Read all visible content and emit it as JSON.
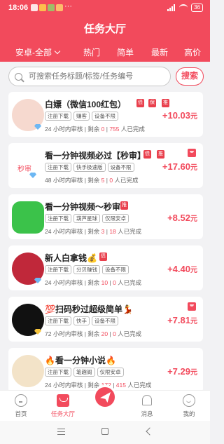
{
  "status_bar": {
    "time": "18:06",
    "more": "···",
    "battery": "36"
  },
  "header": {
    "title": "任务大厅",
    "region_filter": "安卓-全部",
    "tabs": [
      "热门",
      "简单",
      "最新",
      "高价"
    ]
  },
  "search": {
    "placeholder": "可搜索任务标题/标签/任务编号",
    "button_label": "搜索"
  },
  "tasks": [
    {
      "title": "白嫖（微信100红包）",
      "badges": [
        "债",
        "保",
        "推"
      ],
      "tags": [
        "注册下载",
        "赚客",
        "设备不限"
      ],
      "review": "24 小时内审核",
      "remaining_label": "剩余",
      "remaining": "0",
      "completed": "755",
      "completed_label": "人已完成",
      "price": "+10.03",
      "price_unit": "元"
    },
    {
      "title": "看一分钟视频必过【秒审】",
      "badges": [
        "债",
        "推"
      ],
      "thumb_text": "秒审",
      "tags": [
        "注册下载",
        "快手极速版",
        "设备不限"
      ],
      "review": "48 小时内审核",
      "remaining_label": "剩余",
      "remaining": "5",
      "completed": "0",
      "completed_label": "人已完成",
      "price": "+17.60",
      "price_unit": "元"
    },
    {
      "title": "看一分钟视频～秒审",
      "badges": [
        "推"
      ],
      "tags": [
        "注册下载",
        "葫芦星球",
        "仅限安卓"
      ],
      "review": "24 小时内审核",
      "remaining_label": "剩余",
      "remaining": "3",
      "completed": "18",
      "completed_label": "人已完成",
      "price": "+8.52",
      "price_unit": "元"
    },
    {
      "title": "新人白拿钱💰",
      "badges": [
        "债"
      ],
      "tags": [
        "注册下载",
        "分贝赚钱",
        "设备不限"
      ],
      "review": "24 小时内审核",
      "remaining_label": "剩余",
      "remaining": "10",
      "completed": "0",
      "completed_label": "人已完成",
      "price": "+4.40",
      "price_unit": "元"
    },
    {
      "title": "💯扫码秒过超级简单💃",
      "badges": [],
      "tags": [
        "注册下载",
        "快手",
        "设备不限"
      ],
      "review": "72 小时内审核",
      "remaining_label": "剩余",
      "remaining": "20",
      "completed": "0",
      "completed_label": "人已完成",
      "price": "+7.81",
      "price_unit": "元"
    },
    {
      "title": "🔥看一分钟小说🔥",
      "badges": [],
      "tags": [
        "注册下载",
        "笔趣阁",
        "仅限安卓"
      ],
      "review": "24 小时内审核",
      "remaining_label": "剩余",
      "remaining": "172",
      "completed": "415",
      "completed_label": "人已完成",
      "price": "+7.29",
      "price_unit": "元"
    }
  ],
  "bottom_nav": [
    "首页",
    "任务大厅",
    "消息",
    "我的"
  ],
  "colors": {
    "accent": "#f24a5c",
    "badge_red": "#e9404d",
    "gem_blue": "#6db7f3"
  }
}
